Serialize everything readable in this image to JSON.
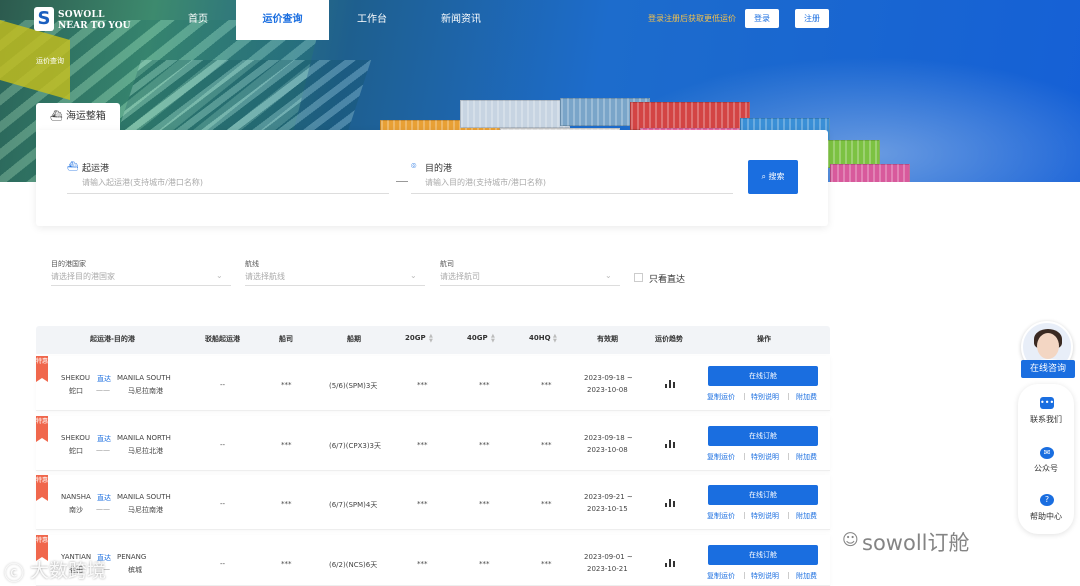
{
  "brand": {
    "logo_letter": "S",
    "line1": "SOWOLL",
    "line2": "NEAR TO YOU"
  },
  "nav": {
    "items": [
      "首页",
      "运价查询",
      "工作台",
      "新闻资讯"
    ],
    "active_index": 1,
    "promo": "登录注册后获取更低运价",
    "login": "登录",
    "register": "注册"
  },
  "breadcrumb": "运价查询",
  "search": {
    "tab_label": "海运整箱",
    "origin_label": "起运港",
    "origin_placeholder": "请输入起运港(支持城市/港口名称)",
    "dest_label": "目的港",
    "dest_placeholder": "请输入目的港(支持城市/港口名称)",
    "button": "搜索"
  },
  "filters": {
    "country_label": "目的港国家",
    "country_placeholder": "请选择目的港国家",
    "route_label": "航线",
    "route_placeholder": "请选择航线",
    "carrier_label": "航司",
    "carrier_placeholder": "请选择航司",
    "direct_only": "只看直达"
  },
  "table": {
    "headers": [
      "起运港-目的港",
      "驳船起运港",
      "船司",
      "船期",
      "20GP",
      "40GP",
      "40HQ",
      "有效期",
      "运价趋势",
      "操作"
    ],
    "tag_text": "特惠",
    "book_label": "在线订舱",
    "links": [
      "复制运价",
      "特别说明",
      "附加费"
    ],
    "rows": [
      {
        "pol": "SHEKOU",
        "pol_cn": "蛇口",
        "mode": "直达",
        "pod": "MANILA SOUTH",
        "pod_cn": "马尼拉南港",
        "barge": "--",
        "carrier": "***",
        "schedule": "(5/6)(SPM)3天",
        "gp20": "***",
        "gp40": "***",
        "hq40": "***",
        "valid_from": "2023-09-18 ~",
        "valid_to": "2023-10-08"
      },
      {
        "pol": "SHEKOU",
        "pol_cn": "蛇口",
        "mode": "直达",
        "pod": "MANILA NORTH",
        "pod_cn": "马尼拉北港",
        "barge": "--",
        "carrier": "***",
        "schedule": "(6/7)(CPX3)3天",
        "gp20": "***",
        "gp40": "***",
        "hq40": "***",
        "valid_from": "2023-09-18 ~",
        "valid_to": "2023-10-08"
      },
      {
        "pol": "NANSHA",
        "pol_cn": "南沙",
        "mode": "直达",
        "pod": "MANILA SOUTH",
        "pod_cn": "马尼拉南港",
        "barge": "--",
        "carrier": "***",
        "schedule": "(6/7)(SPM)4天",
        "gp20": "***",
        "gp40": "***",
        "hq40": "***",
        "valid_from": "2023-09-21 ~",
        "valid_to": "2023-10-15"
      },
      {
        "pol": "YANTIAN",
        "pol_cn": "盐田",
        "mode": "直达",
        "pod": "PENANG",
        "pod_cn": "槟城",
        "barge": "--",
        "carrier": "***",
        "schedule": "(6/2)(NCS)6天",
        "gp20": "***",
        "gp40": "***",
        "hq40": "***",
        "valid_from": "2023-09-01 ~",
        "valid_to": "2023-10-21"
      }
    ]
  },
  "side": {
    "consult": "在线咨询",
    "contact": "联系我们",
    "wechat": "公众号",
    "help": "帮助中心"
  },
  "watermarks": {
    "right": "sowoll订舱",
    "left": "大数跨境"
  },
  "colors": {
    "accent": "#1a6ee0",
    "tag": "#f0674c",
    "promo": "#f2c14e"
  }
}
